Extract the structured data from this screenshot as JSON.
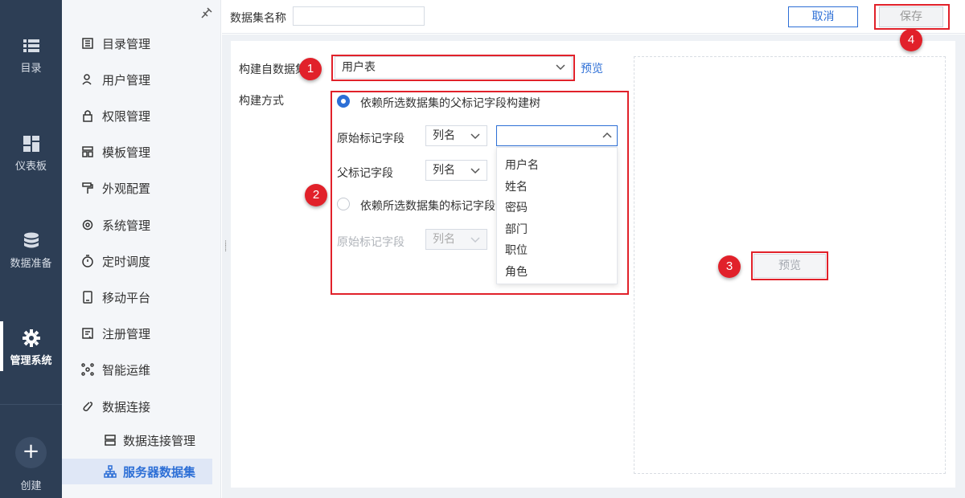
{
  "rail": {
    "items": [
      {
        "label": "目录",
        "icon": "list-icon"
      },
      {
        "label": "仪表板",
        "icon": "dashboard-icon"
      },
      {
        "label": "数据准备",
        "icon": "database-icon"
      },
      {
        "label": "管理系统",
        "icon": "gear-icon"
      }
    ],
    "create_label": "创建",
    "create_symbol": "+"
  },
  "menu": {
    "items": [
      {
        "label": "目录管理",
        "icon": "catalog-icon"
      },
      {
        "label": "用户管理",
        "icon": "user-icon"
      },
      {
        "label": "权限管理",
        "icon": "lock-icon"
      },
      {
        "label": "模板管理",
        "icon": "template-icon"
      },
      {
        "label": "外观配置",
        "icon": "paint-roller-icon"
      },
      {
        "label": "系统管理",
        "icon": "settings-icon"
      },
      {
        "label": "定时调度",
        "icon": "timer-icon"
      },
      {
        "label": "移动平台",
        "icon": "mobile-icon"
      },
      {
        "label": "注册管理",
        "icon": "register-icon"
      },
      {
        "label": "智能运维",
        "icon": "network-icon"
      },
      {
        "label": "数据连接",
        "icon": "link-icon"
      }
    ],
    "sub_items": [
      {
        "label": "数据连接管理",
        "icon": "server-icon"
      },
      {
        "label": "服务器数据集",
        "icon": "tree-icon"
      }
    ]
  },
  "topbar": {
    "dataset_name_label": "数据集名称",
    "dataset_name_value": "",
    "cancel_label": "取消",
    "save_label": "保存"
  },
  "form": {
    "source_label": "构建自数据集",
    "source_value": "用户表",
    "source_preview_link": "预览",
    "method_label": "构建方式",
    "option1_label": "依赖所选数据集的父标记字段构建树",
    "option2_label": "依赖所选数据集的标记字段的",
    "orig_field_label": "原始标记字段",
    "parent_field_label": "父标记字段",
    "column_placeholder": "列名",
    "orig_field_label_2": "原始标记字段",
    "dropdown_options": [
      "用户名",
      "姓名",
      "密码",
      "部门",
      "职位",
      "角色"
    ]
  },
  "preview": {
    "button_label": "预览"
  },
  "annotations": [
    "1",
    "2",
    "3",
    "4"
  ],
  "colors": {
    "accent": "#2d6fd6",
    "rail_bg": "#2d3e55",
    "annotation_red": "#e1212a"
  }
}
